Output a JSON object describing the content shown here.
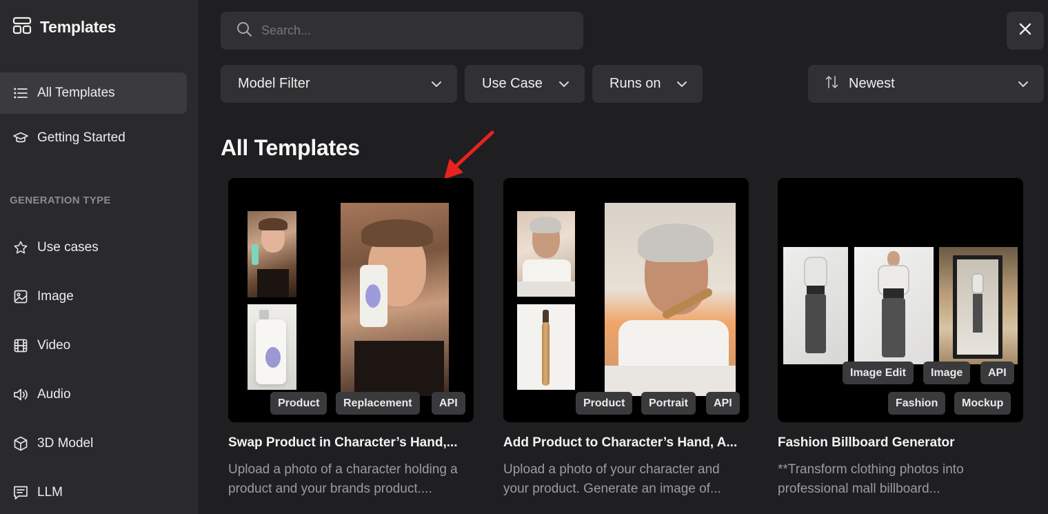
{
  "sidebar": {
    "title": "Templates",
    "nav": [
      {
        "label": "All Templates",
        "icon": "list-icon"
      },
      {
        "label": "Getting Started",
        "icon": "graduation-cap-icon"
      }
    ],
    "section_label": "GENERATION TYPE",
    "types": [
      {
        "label": "Use cases",
        "icon": "star-icon"
      },
      {
        "label": "Image",
        "icon": "image-icon"
      },
      {
        "label": "Video",
        "icon": "film-icon"
      },
      {
        "label": "Audio",
        "icon": "speaker-icon"
      },
      {
        "label": "3D Model",
        "icon": "cube-icon"
      },
      {
        "label": "LLM",
        "icon": "message-icon"
      }
    ]
  },
  "search": {
    "placeholder": "Search...",
    "value": ""
  },
  "filters": {
    "model": "Model Filter",
    "use_case": "Use Case",
    "runs_on": "Runs on",
    "sort": "Newest"
  },
  "heading": "All Templates",
  "cards": [
    {
      "title": "Swap Product in Character’s Hand,...",
      "description": "Upload a photo of a character holding a product and your brands product....",
      "tags": [
        "Product",
        "Replacement",
        "API"
      ]
    },
    {
      "title": "Add Product to Character’s Hand, A...",
      "description": "Upload a photo of your character and your product. Generate an image of...",
      "tags": [
        "Product",
        "Portrait",
        "API"
      ]
    },
    {
      "title": "Fashion Billboard Generator",
      "description": "**Transform clothing photos into professional mall billboard...",
      "tags": [
        "Image Edit",
        "Image",
        "API",
        "Fashion",
        "Mockup"
      ]
    }
  ],
  "colors": {
    "background": "#1f1f21",
    "sidebar": "#2a2a2d",
    "control": "#313134",
    "annotation_arrow": "#e8231d"
  }
}
